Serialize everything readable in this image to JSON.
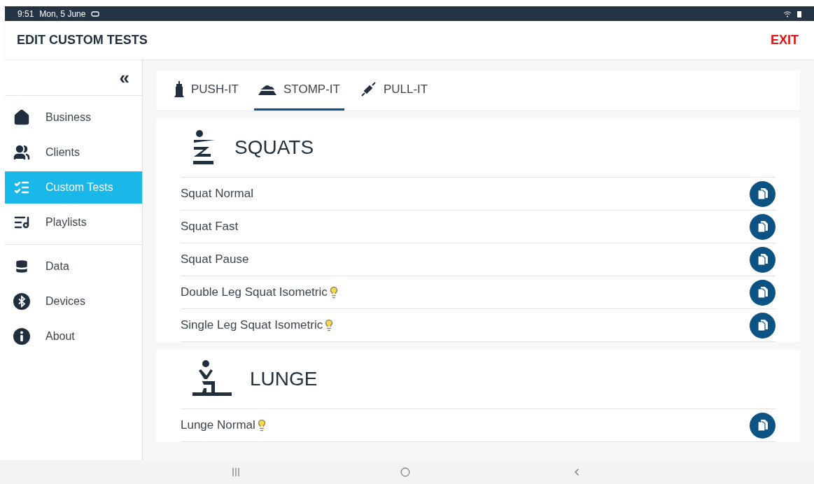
{
  "status_bar": {
    "time": "9:51",
    "date": "Mon, 5 June"
  },
  "header": {
    "title": "EDIT CUSTOM TESTS",
    "exit": "EXIT"
  },
  "sidebar": {
    "collapse": "«",
    "groups": [
      [
        {
          "label": "Business",
          "kind": "business",
          "selected": false
        },
        {
          "label": "Clients",
          "kind": "clients",
          "selected": false
        },
        {
          "label": "Custom Tests",
          "kind": "tests",
          "selected": true
        },
        {
          "label": "Playlists",
          "kind": "playlists",
          "selected": false
        }
      ],
      [
        {
          "label": "Data",
          "kind": "data",
          "selected": false
        },
        {
          "label": "Devices",
          "kind": "devices",
          "selected": false
        },
        {
          "label": "About",
          "kind": "about",
          "selected": false
        }
      ]
    ]
  },
  "tabs": [
    {
      "label": "PUSH-IT",
      "kind": "push",
      "selected": false
    },
    {
      "label": "STOMP-IT",
      "kind": "stomp",
      "selected": true
    },
    {
      "label": "PULL-IT",
      "kind": "pull",
      "selected": false
    }
  ],
  "sections": [
    {
      "title": "SQUATS",
      "kind": "squat",
      "exercises": [
        {
          "name": "Squat Normal",
          "hint": false
        },
        {
          "name": "Squat Fast",
          "hint": false
        },
        {
          "name": "Squat Pause",
          "hint": false
        },
        {
          "name": "Double Leg Squat Isometric",
          "hint": true
        },
        {
          "name": "Single Leg Squat Isometric",
          "hint": true
        }
      ]
    },
    {
      "title": "LUNGE",
      "kind": "lunge",
      "exercises": [
        {
          "name": "Lunge Normal",
          "hint": true
        }
      ]
    }
  ]
}
